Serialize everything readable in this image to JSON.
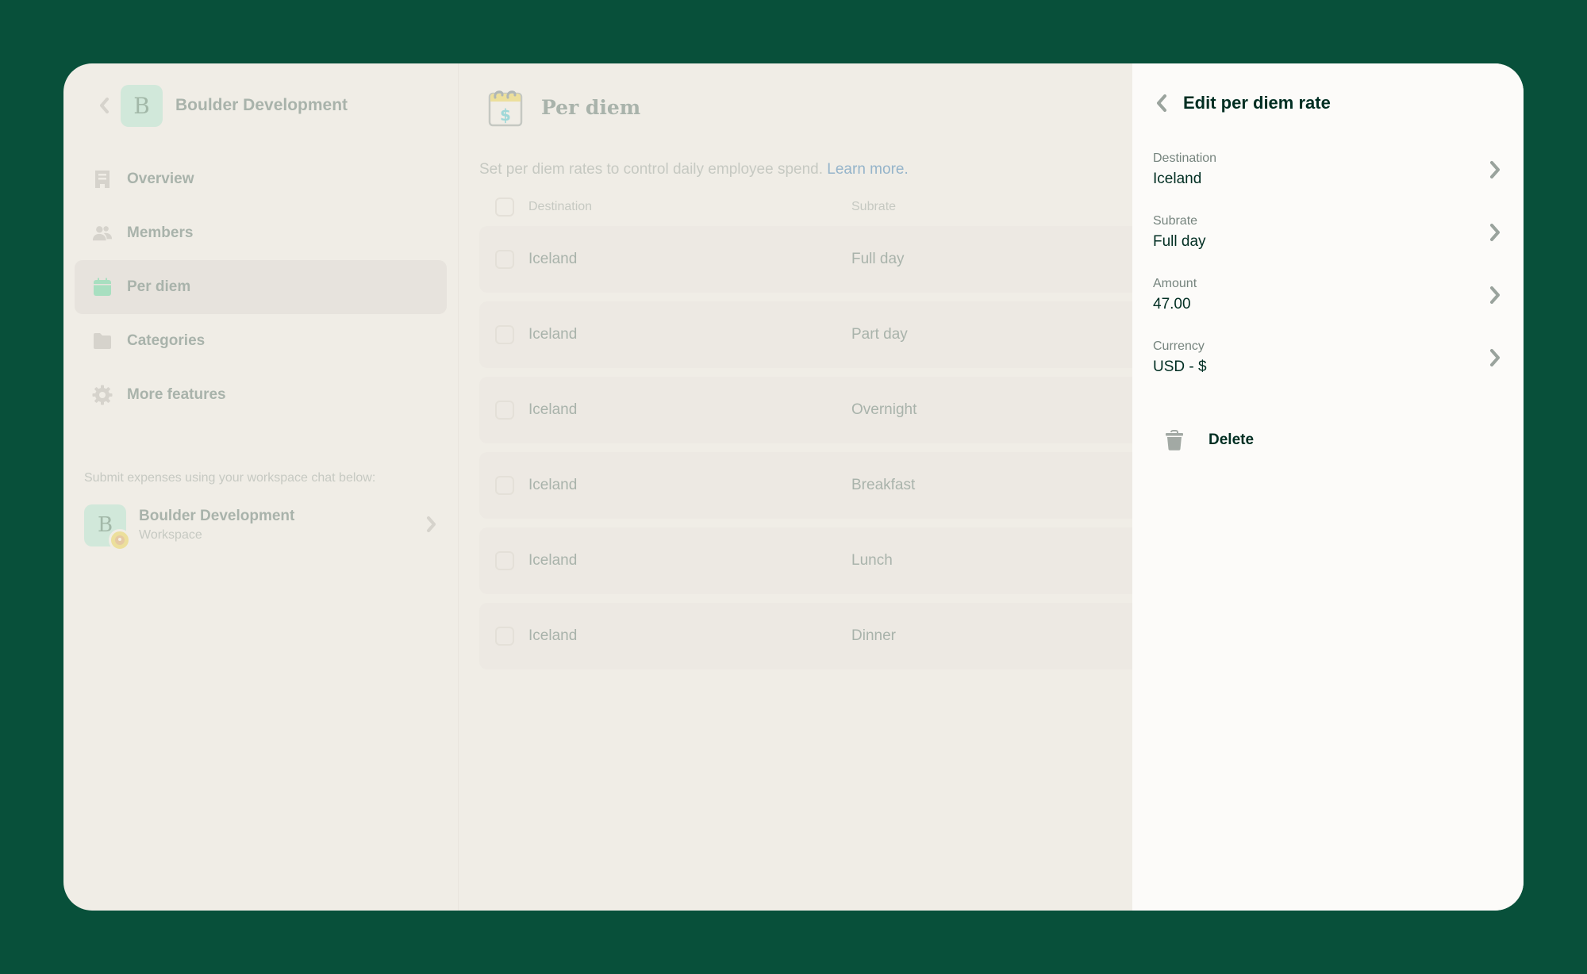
{
  "sidebar": {
    "workspace_name": "Boulder Development",
    "workspace_initial": "B",
    "nav": [
      {
        "label": "Overview",
        "icon": "building-icon",
        "active": false
      },
      {
        "label": "Members",
        "icon": "users-icon",
        "active": false
      },
      {
        "label": "Per diem",
        "icon": "calendar-icon",
        "active": true
      },
      {
        "label": "Categories",
        "icon": "folder-icon",
        "active": false
      },
      {
        "label": "More features",
        "icon": "gear-icon",
        "active": false
      }
    ],
    "submit_hint": "Submit expenses using your workspace chat below:",
    "workspace_chat": {
      "title": "Boulder Development",
      "subtitle": "Workspace",
      "initial": "B"
    }
  },
  "main": {
    "title": "Per diem",
    "description": "Set per diem rates to control daily employee spend.",
    "learn_more": "Learn more.",
    "columns": {
      "destination": "Destination",
      "subrate": "Subrate"
    },
    "rows": [
      {
        "destination": "Iceland",
        "subrate": "Full day"
      },
      {
        "destination": "Iceland",
        "subrate": "Part day"
      },
      {
        "destination": "Iceland",
        "subrate": "Overnight"
      },
      {
        "destination": "Iceland",
        "subrate": "Breakfast"
      },
      {
        "destination": "Iceland",
        "subrate": "Lunch"
      },
      {
        "destination": "Iceland",
        "subrate": "Dinner"
      }
    ]
  },
  "panel": {
    "title": "Edit per diem rate",
    "fields": [
      {
        "label": "Destination",
        "value": "Iceland"
      },
      {
        "label": "Subrate",
        "value": "Full day"
      },
      {
        "label": "Amount",
        "value": "47.00"
      },
      {
        "label": "Currency",
        "value": "USD - $"
      }
    ],
    "delete_label": "Delete"
  },
  "colors": {
    "backdrop": "#08503a",
    "accent_green": "#a8dfc0",
    "text_dark": "#002e22",
    "link": "#95b4ca"
  }
}
